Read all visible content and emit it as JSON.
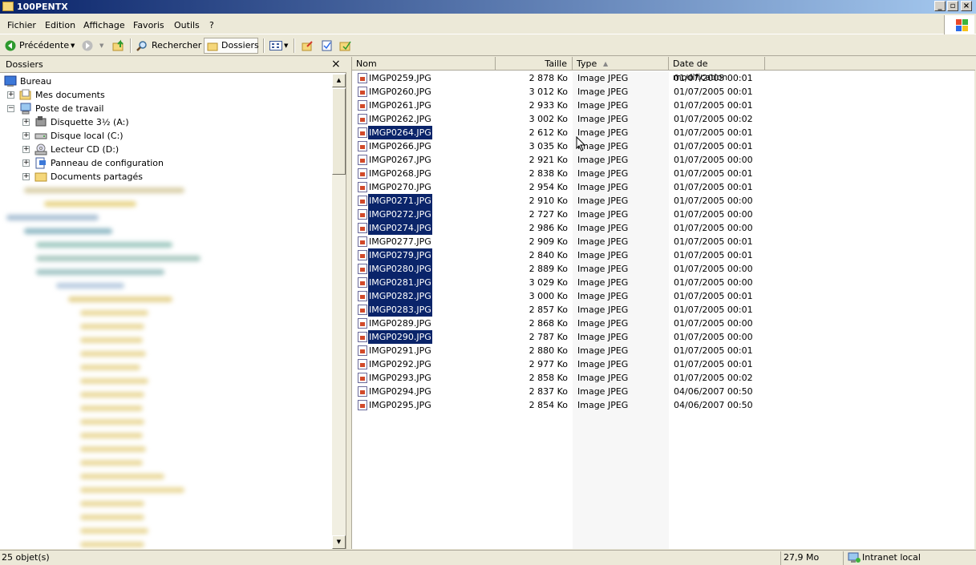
{
  "window": {
    "title": "100PENTX"
  },
  "menu": [
    "Fichier",
    "Edition",
    "Affichage",
    "Favoris",
    "Outils",
    "?"
  ],
  "toolbar": {
    "back_label": "Précédente",
    "search_label": "Rechercher",
    "folders_label": "Dossiers"
  },
  "folders_pane": {
    "title": "Dossiers",
    "tree": [
      {
        "label": "Bureau",
        "icon": "desktop-icon"
      },
      {
        "label": "Mes documents",
        "icon": "documents-icon"
      },
      {
        "label": "Poste de travail",
        "icon": "computer-icon"
      },
      {
        "label": "Disquette 3½ (A:)",
        "icon": "floppy-icon"
      },
      {
        "label": "Disque local (C:)",
        "icon": "harddisk-icon"
      },
      {
        "label": "Lecteur CD (D:)",
        "icon": "cd-drive-icon"
      },
      {
        "label": "Panneau de configuration",
        "icon": "control-panel-icon"
      },
      {
        "label": "Documents partagés",
        "icon": "folder-icon"
      }
    ]
  },
  "file_list": {
    "columns": {
      "name": "Nom",
      "size": "Taille",
      "type": "Type",
      "date": "Date de modification"
    },
    "files": [
      {
        "name": "IMGP0259.JPG",
        "size": "2 878 Ko",
        "type": "Image JPEG",
        "date": "01/07/2005 00:01",
        "selected": false
      },
      {
        "name": "IMGP0260.JPG",
        "size": "3 012 Ko",
        "type": "Image JPEG",
        "date": "01/07/2005 00:01",
        "selected": false
      },
      {
        "name": "IMGP0261.JPG",
        "size": "2 933 Ko",
        "type": "Image JPEG",
        "date": "01/07/2005 00:01",
        "selected": false
      },
      {
        "name": "IMGP0262.JPG",
        "size": "3 002 Ko",
        "type": "Image JPEG",
        "date": "01/07/2005 00:02",
        "selected": false
      },
      {
        "name": "IMGP0264.JPG",
        "size": "2 612 Ko",
        "type": "Image JPEG",
        "date": "01/07/2005 00:01",
        "selected": true
      },
      {
        "name": "IMGP0266.JPG",
        "size": "3 035 Ko",
        "type": "Image JPEG",
        "date": "01/07/2005 00:01",
        "selected": false
      },
      {
        "name": "IMGP0267.JPG",
        "size": "2 921 Ko",
        "type": "Image JPEG",
        "date": "01/07/2005 00:00",
        "selected": false
      },
      {
        "name": "IMGP0268.JPG",
        "size": "2 838 Ko",
        "type": "Image JPEG",
        "date": "01/07/2005 00:01",
        "selected": false
      },
      {
        "name": "IMGP0270.JPG",
        "size": "2 954 Ko",
        "type": "Image JPEG",
        "date": "01/07/2005 00:01",
        "selected": false
      },
      {
        "name": "IMGP0271.JPG",
        "size": "2 910 Ko",
        "type": "Image JPEG",
        "date": "01/07/2005 00:00",
        "selected": true
      },
      {
        "name": "IMGP0272.JPG",
        "size": "2 727 Ko",
        "type": "Image JPEG",
        "date": "01/07/2005 00:00",
        "selected": true
      },
      {
        "name": "IMGP0274.JPG",
        "size": "2 986 Ko",
        "type": "Image JPEG",
        "date": "01/07/2005 00:00",
        "selected": true
      },
      {
        "name": "IMGP0277.JPG",
        "size": "2 909 Ko",
        "type": "Image JPEG",
        "date": "01/07/2005 00:01",
        "selected": false
      },
      {
        "name": "IMGP0279.JPG",
        "size": "2 840 Ko",
        "type": "Image JPEG",
        "date": "01/07/2005 00:01",
        "selected": true
      },
      {
        "name": "IMGP0280.JPG",
        "size": "2 889 Ko",
        "type": "Image JPEG",
        "date": "01/07/2005 00:00",
        "selected": true
      },
      {
        "name": "IMGP0281.JPG",
        "size": "3 029 Ko",
        "type": "Image JPEG",
        "date": "01/07/2005 00:00",
        "selected": true
      },
      {
        "name": "IMGP0282.JPG",
        "size": "3 000 Ko",
        "type": "Image JPEG",
        "date": "01/07/2005 00:01",
        "selected": true
      },
      {
        "name": "IMGP0283.JPG",
        "size": "2 857 Ko",
        "type": "Image JPEG",
        "date": "01/07/2005 00:01",
        "selected": true
      },
      {
        "name": "IMGP0289.JPG",
        "size": "2 868 Ko",
        "type": "Image JPEG",
        "date": "01/07/2005 00:00",
        "selected": false
      },
      {
        "name": "IMGP0290.JPG",
        "size": "2 787 Ko",
        "type": "Image JPEG",
        "date": "01/07/2005 00:00",
        "selected": true
      },
      {
        "name": "IMGP0291.JPG",
        "size": "2 880 Ko",
        "type": "Image JPEG",
        "date": "01/07/2005 00:01",
        "selected": false
      },
      {
        "name": "IMGP0292.JPG",
        "size": "2 977 Ko",
        "type": "Image JPEG",
        "date": "01/07/2005 00:01",
        "selected": false
      },
      {
        "name": "IMGP0293.JPG",
        "size": "2 858 Ko",
        "type": "Image JPEG",
        "date": "01/07/2005 00:02",
        "selected": false
      },
      {
        "name": "IMGP0294.JPG",
        "size": "2 837 Ko",
        "type": "Image JPEG",
        "date": "04/06/2007 00:50",
        "selected": false
      },
      {
        "name": "IMGP0295.JPG",
        "size": "2 854 Ko",
        "type": "Image JPEG",
        "date": "04/06/2007 00:50",
        "selected": false
      }
    ]
  },
  "statusbar": {
    "object_count": "25 objet(s)",
    "total_size": "27,9 Mo",
    "zone": "Intranet local"
  },
  "colors": {
    "selection": "#0a246a",
    "chrome": "#ece9d8",
    "title_start": "#0a246a"
  }
}
